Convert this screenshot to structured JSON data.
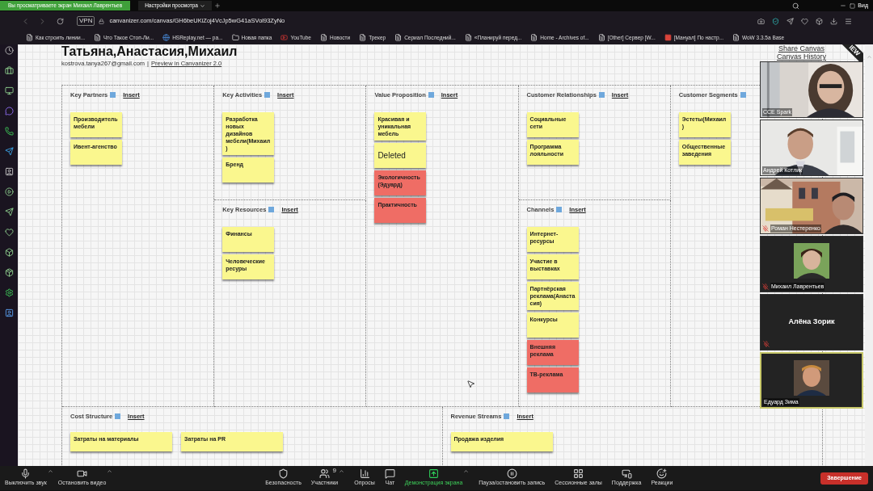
{
  "zoom_bar": {
    "banner": "Вы просматриваете экран Михаил Лаврентьев",
    "view_menu": "Настройки просмотра",
    "view_button": "Вид"
  },
  "browser": {
    "vpn": "VPN",
    "url": "canvanizer.com/canvas/GH6beUKiZoj4VcJp5wG41aSVol93ZyNo",
    "bookmarks": [
      {
        "label": "Как строить линии...",
        "kind": "page"
      },
      {
        "label": "Что Такое Стоп-Ли...",
        "kind": "page"
      },
      {
        "label": "HSReplay.net — ра...",
        "kind": "site"
      },
      {
        "label": "Новая папка",
        "kind": "folder"
      },
      {
        "label": "YouTube",
        "kind": "video"
      },
      {
        "label": "Новости",
        "kind": "page"
      },
      {
        "label": "Трекер",
        "kind": "page"
      },
      {
        "label": "Сериал Последний...",
        "kind": "page"
      },
      {
        "label": "«Планируй перед...",
        "kind": "page"
      },
      {
        "label": "Home - Archives of...",
        "kind": "page"
      },
      {
        "label": "[Other] Сервер [W...",
        "kind": "page"
      },
      {
        "label": "[Мануал] По настр...",
        "kind": "manual"
      },
      {
        "label": "WoW 3.3.5a Base",
        "kind": "page"
      }
    ]
  },
  "canvas": {
    "title": "Татьяна,Анастасия,Михаил",
    "email": "kostrova.tanya267@gmail.com",
    "separator": "|",
    "preview_link": "Preview in Canvanizer 2.0",
    "share_link": "Share Canvas",
    "history_link": "Canvas History",
    "ribbon": "IEW",
    "columns": [
      {
        "blocks": [
          {
            "title": "Key Partners",
            "insert": "Insert",
            "notes": [
              {
                "text": "Производитель мебели",
                "kind": "note",
                "color": "#faf78e"
              },
              {
                "text": "Ивент-агенство",
                "kind": "note",
                "color": "#faf78e"
              }
            ]
          }
        ]
      },
      {
        "blocks": [
          {
            "title": "Key Activities",
            "insert": "Insert",
            "notes": [
              {
                "text": "Разработка новых дизайнов мебели(Михаил)",
                "kind": "note",
                "color": "#faf78e"
              },
              {
                "text": "Бренд",
                "kind": "note",
                "color": "#faf78e"
              }
            ]
          },
          {
            "title": "Key Resources",
            "insert": "Insert",
            "notes": [
              {
                "text": "Финансы",
                "kind": "note",
                "color": "#faf78e"
              },
              {
                "text": "Человеческие ресуры",
                "kind": "note",
                "color": "#faf78e"
              }
            ]
          }
        ]
      },
      {
        "blocks": [
          {
            "title": "Value Proposition",
            "insert": "Insert",
            "notes": [
              {
                "text": "Красивая и уникальная мебель",
                "kind": "note",
                "color": "#faf78e"
              },
              {
                "text": "Deleted",
                "kind": "deleted",
                "color": "#faf78e"
              },
              {
                "text": "Экологичность (Эдуард)",
                "kind": "note",
                "color": "#ef6d65"
              },
              {
                "text": "Практичность",
                "kind": "note",
                "color": "#ef6d65"
              }
            ]
          }
        ]
      },
      {
        "blocks": [
          {
            "title": "Customer Relationships",
            "insert": "Insert",
            "notes": [
              {
                "text": "Социальные сети",
                "kind": "note",
                "color": "#faf78e"
              },
              {
                "text": "Программа лояльности",
                "kind": "note",
                "color": "#faf78e"
              }
            ]
          },
          {
            "title": "Channels",
            "insert": "Insert",
            "notes": [
              {
                "text": "Интернет-ресурсы",
                "kind": "note",
                "color": "#faf78e"
              },
              {
                "text": "Участие в выставках",
                "kind": "note",
                "color": "#faf78e"
              },
              {
                "text": "Партнёрская реклама(Анастасия)",
                "kind": "note",
                "color": "#faf78e"
              },
              {
                "text": "Конкурсы",
                "kind": "note",
                "color": "#faf78e"
              },
              {
                "text": "Внешняя реклама",
                "kind": "note",
                "color": "#ef6d65"
              },
              {
                "text": "ТВ-реклама",
                "kind": "note",
                "color": "#ef6d65"
              }
            ]
          }
        ]
      },
      {
        "blocks": [
          {
            "title": "Customer Segments",
            "notes": [
              {
                "text": "Эстеты(Михаил)",
                "kind": "note",
                "color": "#faf78e"
              },
              {
                "text": "Общественные заведения",
                "kind": "note",
                "color": "#faf78e"
              }
            ]
          }
        ]
      }
    ],
    "bottom_blocks": [
      {
        "title": "Cost Structure",
        "insert": "Insert",
        "notes": [
          {
            "text": "Затраты на материалы",
            "kind": "note",
            "color": "#faf78e"
          },
          {
            "text": "Затраты на PR",
            "kind": "note",
            "color": "#faf78e"
          }
        ]
      },
      {
        "title": "Revenue Streams",
        "insert": "Insert",
        "notes": [
          {
            "text": "Продажа изделия",
            "kind": "note",
            "color": "#faf78e"
          }
        ]
      }
    ]
  },
  "participants": [
    {
      "name": "CCE Spark",
      "kind": "video",
      "muted": false,
      "speaking": false
    },
    {
      "name": "Андрей Котлик",
      "kind": "video",
      "muted": false,
      "speaking": false
    },
    {
      "name": "Роман Нестеренко",
      "kind": "video",
      "muted": true,
      "speaking": false
    },
    {
      "name": "Михаил Лаврентьев",
      "kind": "avatar",
      "muted": true,
      "speaking": false
    },
    {
      "name": "Алёна Зорик",
      "kind": "name",
      "muted": true,
      "speaking": false
    },
    {
      "name": "Едуард Зима",
      "kind": "avatar",
      "muted": false,
      "speaking": true
    }
  ],
  "toolbar": {
    "items": [
      {
        "label": "Выключить звук",
        "caret": true,
        "active": false
      },
      {
        "label": "Остановить видео",
        "caret": true,
        "active": false
      },
      {
        "label": "Безопасность",
        "caret": false,
        "active": false
      },
      {
        "label": "Участники",
        "badge": "9",
        "caret": true,
        "active": false
      },
      {
        "label": "Опросы",
        "caret": false,
        "active": false
      },
      {
        "label": "Чат",
        "caret": false,
        "active": false
      },
      {
        "label": "Демонстрация экрана",
        "caret": true,
        "active": true
      },
      {
        "label": "Пауза/остановить запись",
        "caret": false,
        "active": false
      },
      {
        "label": "Сессионные залы",
        "caret": false,
        "active": false
      },
      {
        "label": "Поддержка",
        "caret": false,
        "active": false
      },
      {
        "label": "Реакции",
        "caret": false,
        "active": false
      }
    ],
    "end_button": "Завершение"
  }
}
